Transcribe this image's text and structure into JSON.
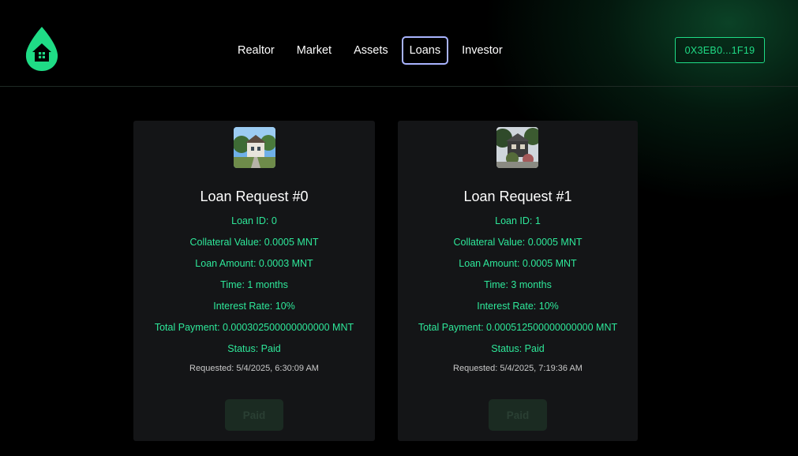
{
  "header": {
    "logo_icon": "house-drop-icon",
    "accent_color": "#1fdc86",
    "nav": [
      {
        "label": "Realtor"
      },
      {
        "label": "Market"
      },
      {
        "label": "Assets"
      },
      {
        "label": "Loans",
        "active": true
      },
      {
        "label": "Investor"
      }
    ],
    "wallet_label": "0X3EB0...1F19"
  },
  "loans": [
    {
      "title": "Loan Request #0",
      "loan_id": "Loan ID: 0",
      "collateral": "Collateral Value: 0.0005 MNT",
      "amount": "Loan Amount: 0.0003 MNT",
      "time": "Time: 1 months",
      "interest": "Interest Rate: 10%",
      "total": "Total Payment: 0.000302500000000000 MNT",
      "status": "Status: Paid",
      "requested": "Requested: 5/4/2025, 6:30:09 AM",
      "button_label": "Paid"
    },
    {
      "title": "Loan Request #1",
      "loan_id": "Loan ID: 1",
      "collateral": "Collateral Value: 0.0005 MNT",
      "amount": "Loan Amount: 0.0005 MNT",
      "time": "Time: 3 months",
      "interest": "Interest Rate: 10%",
      "total": "Total Payment: 0.000512500000000000 MNT",
      "status": "Status: Paid",
      "requested": "Requested: 5/4/2025, 7:19:36 AM",
      "button_label": "Paid"
    }
  ]
}
